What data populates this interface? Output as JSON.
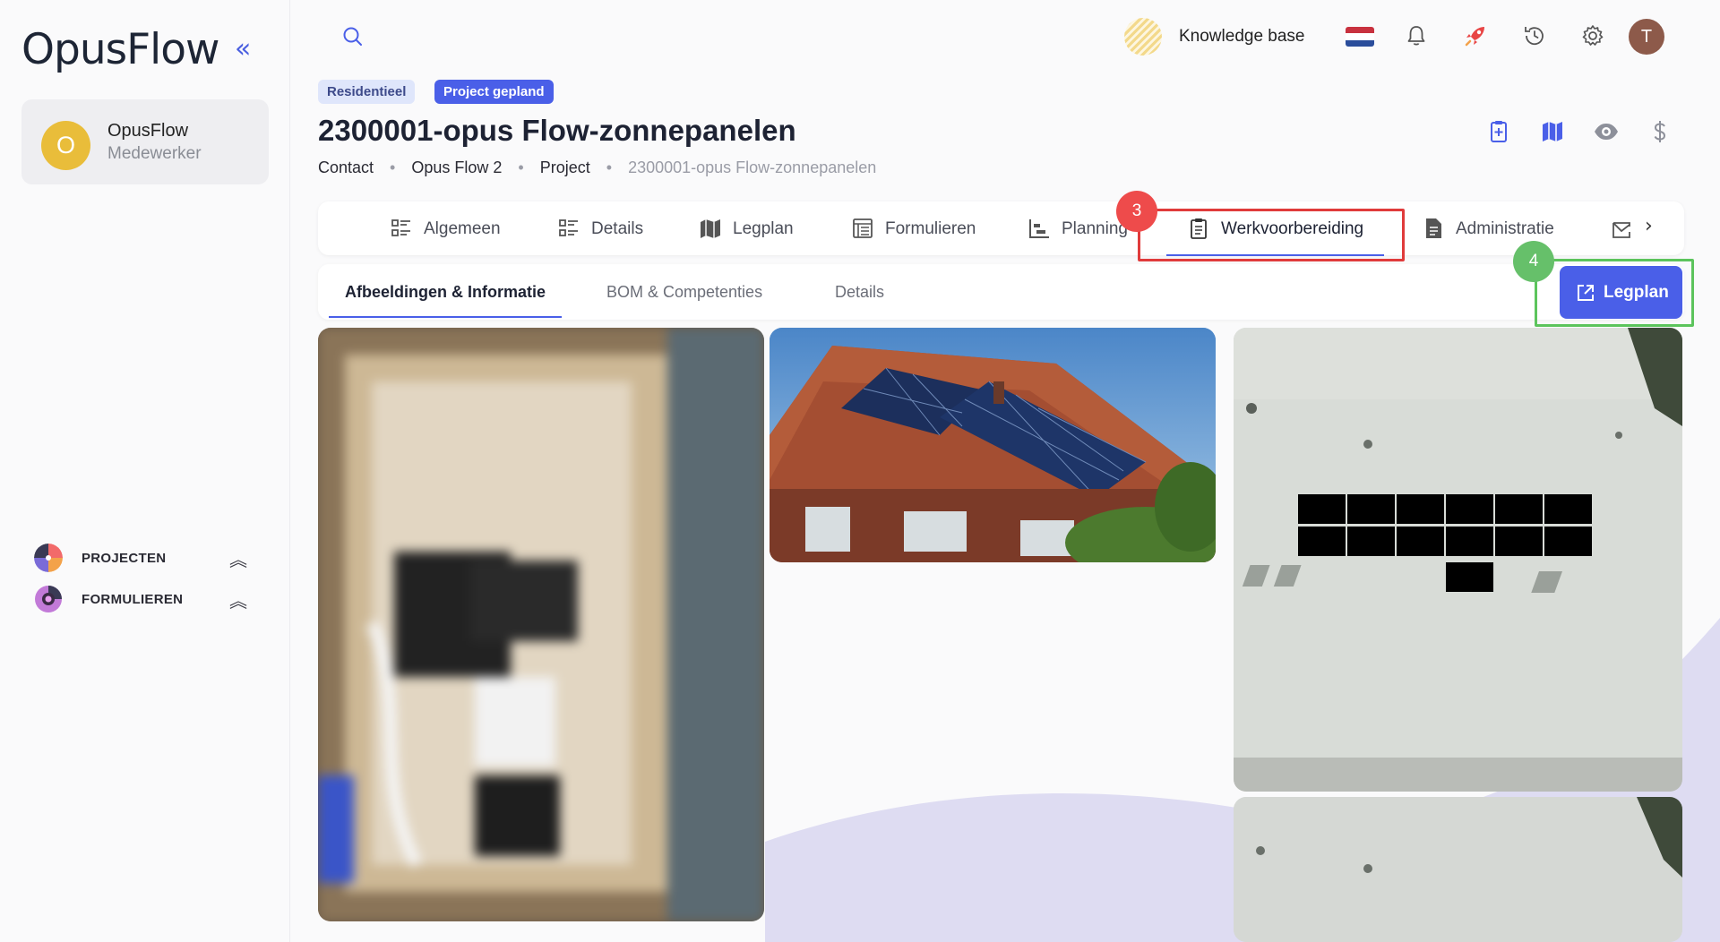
{
  "app": {
    "logo_text": "OpusFlow"
  },
  "sidebar": {
    "user": {
      "initial": "O",
      "name": "OpusFlow",
      "role": "Medewerker"
    },
    "nav": [
      {
        "label": "PROJECTEN",
        "icon": "projects-pie-icon"
      },
      {
        "label": "FORMULIEREN",
        "icon": "forms-ring-icon"
      }
    ]
  },
  "topbar": {
    "knowledge_base_label": "Knowledge base",
    "avatar_initial": "T",
    "icons": [
      "search-icon",
      "netherlands-flag-icon",
      "bell-icon",
      "rocket-icon",
      "history-icon",
      "gear-icon"
    ]
  },
  "project": {
    "badges": [
      "Residentieel",
      "Project gepland"
    ],
    "title": "2300001-opus Flow-zonnepanelen",
    "breadcrumb": [
      "Contact",
      "Opus Flow 2",
      "Project",
      "2300001-opus Flow-zonnepanelen"
    ]
  },
  "tabs": [
    {
      "label": "Algemeen",
      "icon": "list-icon"
    },
    {
      "label": "Details",
      "icon": "list-icon"
    },
    {
      "label": "Legplan",
      "icon": "map-icon"
    },
    {
      "label": "Formulieren",
      "icon": "form-icon"
    },
    {
      "label": "Planning",
      "icon": "chart-icon"
    },
    {
      "label": "Werkvoorbereiding",
      "icon": "clipboard-icon",
      "active": true
    },
    {
      "label": "Administratie",
      "icon": "document-icon"
    }
  ],
  "subtabs": [
    {
      "label": "Afbeeldingen & Informatie",
      "active": true
    },
    {
      "label": "BOM & Competenties"
    },
    {
      "label": "Details"
    }
  ],
  "annotations": {
    "step_3": "3",
    "step_4": "4"
  },
  "actions": {
    "legplan_button": "Legplan"
  },
  "colors": {
    "accent": "#4a5fe8",
    "highlight_red": "#e03b3b",
    "highlight_green": "#5cc45c",
    "avatar_yellow": "#e9bd3a"
  }
}
